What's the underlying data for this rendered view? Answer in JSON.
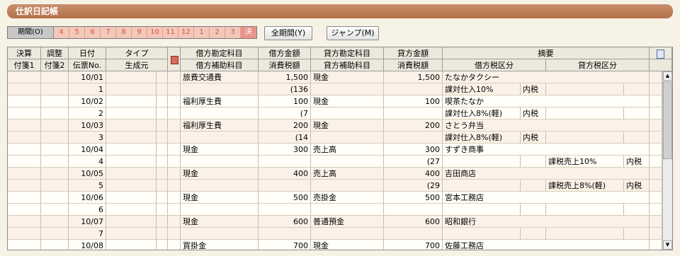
{
  "window": {
    "title": "仕訳日記帳"
  },
  "period": {
    "label": "期間(O)",
    "months": [
      "4",
      "5",
      "6",
      "7",
      "8",
      "9",
      "10",
      "11",
      "12",
      "1",
      "2",
      "3",
      "決"
    ],
    "all_period_label": "全期間(Y)",
    "jump_label": "ジャンプ(M)"
  },
  "columns": {
    "kessan": "決算",
    "chosei": "調整",
    "hizuke": "日付",
    "type": "タイプ",
    "karikata_kamoku": "借方勘定科目",
    "karikata_kingaku": "借方金額",
    "kashikata_kamoku": "貸方勘定科目",
    "kashikata_kingaku": "貸方金額",
    "tekiyo": "摘要",
    "fusen1": "付箋1",
    "fusen2": "付箋2",
    "denpyo_no": "伝票No.",
    "seiseimoto": "生成元",
    "karikata_hojo": "借方補助科目",
    "karikata_shohizei": "消費税額",
    "kashikata_hojo": "貸方補助科目",
    "kashikata_shohizei": "消費税額",
    "karikata_zeikubun": "借方税区分",
    "kashikata_zeikubun": "貸方税区分"
  },
  "entries": [
    {
      "date": "10/01",
      "no": "1",
      "dr_account": "旅費交通費",
      "dr_amount": "1,500",
      "dr_tax": "(136",
      "cr_account": "現金",
      "cr_amount": "1,500",
      "cr_tax": "",
      "memo": "たなかタクシー",
      "dr_tax_class": "課対仕入10%",
      "dr_tax_mode": "内税",
      "cr_tax_class": "",
      "cr_tax_mode": ""
    },
    {
      "date": "10/02",
      "no": "2",
      "dr_account": "福利厚生費",
      "dr_amount": "100",
      "dr_tax": "(7",
      "cr_account": "現金",
      "cr_amount": "100",
      "cr_tax": "",
      "memo": "喫茶たなか",
      "dr_tax_class": "課対仕入8%(軽)",
      "dr_tax_mode": "内税",
      "cr_tax_class": "",
      "cr_tax_mode": ""
    },
    {
      "date": "10/03",
      "no": "3",
      "dr_account": "福利厚生費",
      "dr_amount": "200",
      "dr_tax": "(14",
      "cr_account": "現金",
      "cr_amount": "200",
      "cr_tax": "",
      "memo": "さとう弁当",
      "dr_tax_class": "課対仕入8%(軽)",
      "dr_tax_mode": "内税",
      "cr_tax_class": "",
      "cr_tax_mode": ""
    },
    {
      "date": "10/04",
      "no": "4",
      "dr_account": "現金",
      "dr_amount": "300",
      "dr_tax": "",
      "cr_account": "売上高",
      "cr_amount": "300",
      "cr_tax": "(27",
      "memo": "すずき商事",
      "dr_tax_class": "",
      "dr_tax_mode": "",
      "cr_tax_class": "課税売上10%",
      "cr_tax_mode": "内税"
    },
    {
      "date": "10/05",
      "no": "5",
      "dr_account": "現金",
      "dr_amount": "400",
      "dr_tax": "",
      "cr_account": "売上高",
      "cr_amount": "400",
      "cr_tax": "(29",
      "memo": "吉田商店",
      "dr_tax_class": "",
      "dr_tax_mode": "",
      "cr_tax_class": "課税売上8%(軽)",
      "cr_tax_mode": "内税"
    },
    {
      "date": "10/06",
      "no": "6",
      "dr_account": "現金",
      "dr_amount": "500",
      "dr_tax": "",
      "cr_account": "売掛金",
      "cr_amount": "500",
      "cr_tax": "",
      "memo": "宮本工務店",
      "dr_tax_class": "",
      "dr_tax_mode": "",
      "cr_tax_class": "",
      "cr_tax_mode": ""
    },
    {
      "date": "10/07",
      "no": "7",
      "dr_account": "現金",
      "dr_amount": "600",
      "dr_tax": "",
      "cr_account": "普通預金",
      "cr_amount": "600",
      "cr_tax": "",
      "memo": "昭和銀行",
      "dr_tax_class": "",
      "dr_tax_mode": "",
      "cr_tax_class": "",
      "cr_tax_mode": ""
    },
    {
      "date": "10/08",
      "no": "",
      "dr_account": "買掛金",
      "dr_amount": "700",
      "dr_tax": "",
      "cr_account": "現金",
      "cr_amount": "700",
      "cr_tax": "",
      "memo": "佐藤工務店",
      "dr_tax_class": "",
      "dr_tax_mode": "",
      "cr_tax_class": "",
      "cr_tax_mode": ""
    }
  ]
}
